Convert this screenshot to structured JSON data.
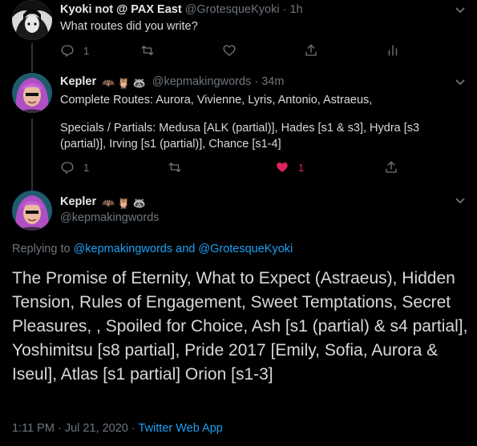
{
  "tweets": [
    {
      "name": "Kyoki not @ PAX East",
      "handle": "@GrotesqueKyoki",
      "separator": "·",
      "time": "1h",
      "text": "What routes did you write?",
      "reply_count": "1",
      "like_count": ""
    },
    {
      "name": "Kepler",
      "handle": "@kepmakingwords",
      "separator": "·",
      "time": "34m",
      "text_line1": "Complete Routes: Aurora, Vivienne, Lyris, Antonio, Astraeus,",
      "text_line2": "Specials / Partials: Medusa [ALK (partial)], Hades [s1 & s3], Hydra [s3",
      "text_line3": "(partial)], Irving [s1 (partial)], Chance [s1-4]",
      "reply_count": "1",
      "like_count": "1"
    }
  ],
  "main_tweet": {
    "name": "Kepler",
    "handle": "@kepmakingwords",
    "replying_prefix": "Replying to",
    "replying_user1": "@kepmakingwords",
    "replying_and": "and",
    "replying_user2": "@GrotesqueKyoki",
    "text": "The Promise of Eternity, What to Expect (Astraeus), Hidden Tension, Rules of Engagement, Sweet Temptations, Secret Pleasures, , Spoiled for Choice, Ash [s1 (partial) & s4 partial], Yoshimitsu [s8 partial], Pride 2017 [Emily, Sofia, Aurora & Iseul], Atlas [s1 partial] Orion [s1-3]",
    "time": "1:11 PM",
    "separator": "·",
    "date": "Jul 21, 2020",
    "separator2": "·",
    "source": "Twitter Web App"
  },
  "emoji": {
    "bat": "🦇",
    "owl": "🦉",
    "raccoon": "🦝"
  },
  "colors": {
    "background": "#000000",
    "accent": "#1da1f2",
    "like": "#e0245e",
    "muted": "#6e767d"
  }
}
